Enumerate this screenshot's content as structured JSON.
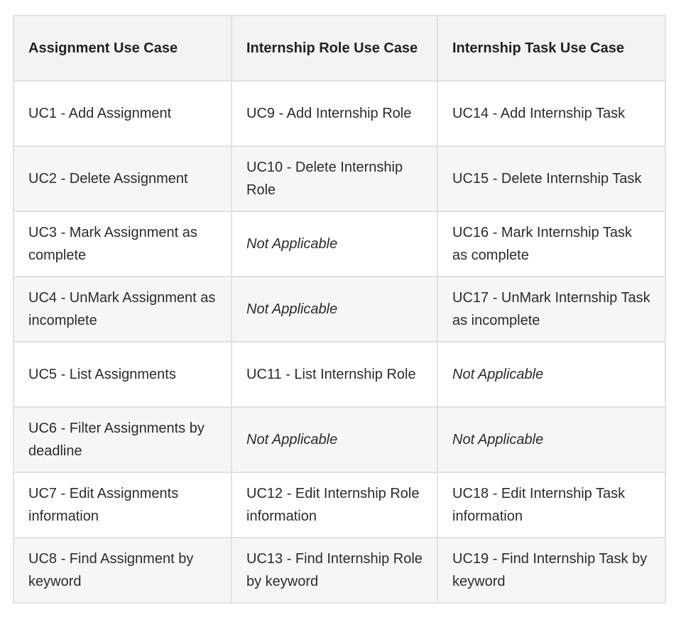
{
  "table": {
    "headers": [
      "Assignment Use Case",
      "Internship Role Use Case",
      "Internship Task Use Case"
    ],
    "rows": [
      [
        "UC1 - Add Assignment",
        "UC9 - Add Internship Role",
        "UC14 - Add Internship Task"
      ],
      [
        "UC2 - Delete Assignment",
        "UC10 - Delete Internship Role",
        "UC15 - Delete Internship Task"
      ],
      [
        "UC3 - Mark Assignment as complete",
        "Not Applicable",
        "UC16 - Mark Internship Task as complete"
      ],
      [
        "UC4 - UnMark Assignment as incomplete",
        "Not Applicable",
        "UC17 - UnMark Internship Task as incomplete"
      ],
      [
        "UC5 - List Assignments",
        "UC11 - List Internship Role",
        "Not Applicable"
      ],
      [
        "UC6 - Filter Assignments by deadline",
        "Not Applicable",
        "Not Applicable"
      ],
      [
        "UC7 - Edit Assignments information",
        "UC12 - Edit Internship Role information",
        "UC18 - Edit Internship Task information"
      ],
      [
        "UC8 - Find Assignment by keyword",
        "UC13 - Find Internship Role by keyword",
        "UC19 - Find Internship Task by keyword"
      ]
    ]
  }
}
